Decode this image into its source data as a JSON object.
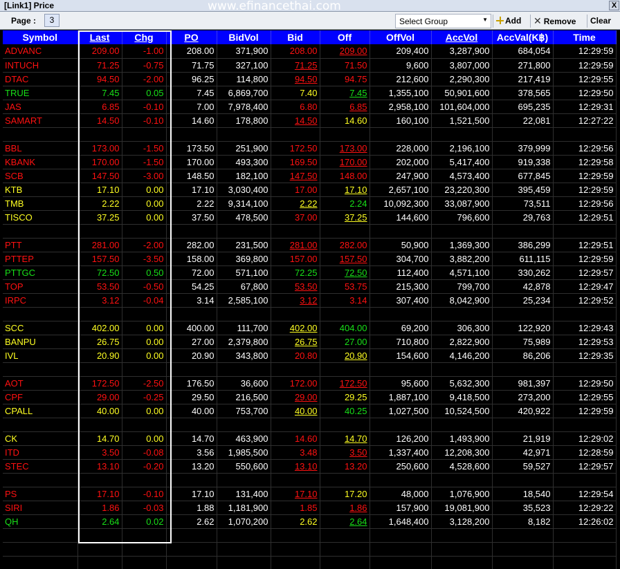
{
  "window": {
    "title": "[Link1] Price",
    "watermark": "www.efinancethai.com",
    "close": "X"
  },
  "toolbar": {
    "page_label": "Page :",
    "page_value": "3",
    "group_placeholder": "Select Group",
    "add": "Add",
    "remove": "Remove",
    "clear": "Clear"
  },
  "columns": [
    "Symbol",
    "Last",
    "Chg",
    "PO",
    "BidVol",
    "Bid",
    "Off",
    "OffVol",
    "AccVol",
    "AccVal(K฿)",
    "Time"
  ],
  "colors": {
    "up": "#18e018",
    "down": "#ff1111",
    "unchanged": "#ffff22",
    "header": "#0000ff"
  },
  "groups": [
    [
      [
        "ADVANC",
        "209.00",
        "-1.00",
        "208.00",
        "371,900",
        "208.00",
        "209.00",
        "209,400",
        "3,287,900",
        "684,054",
        "12:29:59",
        "r",
        "r",
        "r",
        "wh",
        "r",
        "ru",
        "wh"
      ],
      [
        "INTUCH",
        "71.25",
        "-0.75",
        "71.75",
        "327,100",
        "71.25",
        "71.50",
        "9,600",
        "3,807,000",
        "271,800",
        "12:29:59",
        "r",
        "r",
        "r",
        "wh",
        "ru",
        "r",
        "wh"
      ],
      [
        "DTAC",
        "94.50",
        "-2.00",
        "96.25",
        "114,800",
        "94.50",
        "94.75",
        "212,600",
        "2,290,300",
        "217,419",
        "12:29:55",
        "r",
        "r",
        "r",
        "wh",
        "ru",
        "r",
        "wh"
      ],
      [
        "TRUE",
        "7.45",
        "0.05",
        "7.45",
        "6,869,700",
        "7.40",
        "7.45",
        "1,355,100",
        "50,901,600",
        "378,565",
        "12:29:50",
        "g",
        "g",
        "g",
        "wh",
        "y",
        "gu",
        "wh"
      ],
      [
        "JAS",
        "6.85",
        "-0.10",
        "7.00",
        "7,978,400",
        "6.80",
        "6.85",
        "2,958,100",
        "101,604,000",
        "695,235",
        "12:29:31",
        "r",
        "r",
        "r",
        "wh",
        "r",
        "ru",
        "wh"
      ],
      [
        "SAMART",
        "14.50",
        "-0.10",
        "14.60",
        "178,800",
        "14.50",
        "14.60",
        "160,100",
        "1,521,500",
        "22,081",
        "12:27:22",
        "r",
        "r",
        "r",
        "wh",
        "ru",
        "y",
        "wh"
      ]
    ],
    [
      [
        "BBL",
        "173.00",
        "-1.50",
        "173.50",
        "251,900",
        "172.50",
        "173.00",
        "228,000",
        "2,196,100",
        "379,999",
        "12:29:56",
        "r",
        "r",
        "r",
        "wh",
        "r",
        "ru",
        "wh"
      ],
      [
        "KBANK",
        "170.00",
        "-1.50",
        "170.00",
        "493,300",
        "169.50",
        "170.00",
        "202,000",
        "5,417,400",
        "919,338",
        "12:29:58",
        "r",
        "r",
        "r",
        "wh",
        "r",
        "ru",
        "wh"
      ],
      [
        "SCB",
        "147.50",
        "-3.00",
        "148.50",
        "182,100",
        "147.50",
        "148.00",
        "247,900",
        "4,573,400",
        "677,845",
        "12:29:59",
        "r",
        "r",
        "r",
        "wh",
        "ru",
        "r",
        "wh"
      ],
      [
        "KTB",
        "17.10",
        "0.00",
        "17.10",
        "3,030,400",
        "17.00",
        "17.10",
        "2,657,100",
        "23,220,300",
        "395,459",
        "12:29:59",
        "y",
        "y",
        "y",
        "wh",
        "r",
        "yu",
        "wh"
      ],
      [
        "TMB",
        "2.22",
        "0.00",
        "2.22",
        "9,314,100",
        "2.22",
        "2.24",
        "10,092,300",
        "33,087,900",
        "73,511",
        "12:29:56",
        "y",
        "y",
        "y",
        "wh",
        "yu",
        "g",
        "wh"
      ],
      [
        "TISCO",
        "37.25",
        "0.00",
        "37.50",
        "478,500",
        "37.00",
        "37.25",
        "144,600",
        "796,600",
        "29,763",
        "12:29:51",
        "y",
        "y",
        "y",
        "wh",
        "r",
        "yu",
        "wh"
      ]
    ],
    [
      [
        "PTT",
        "281.00",
        "-2.00",
        "282.00",
        "231,500",
        "281.00",
        "282.00",
        "50,900",
        "1,369,300",
        "386,299",
        "12:29:51",
        "r",
        "r",
        "r",
        "wh",
        "ru",
        "r",
        "wh"
      ],
      [
        "PTTEP",
        "157.50",
        "-3.50",
        "158.00",
        "369,800",
        "157.00",
        "157.50",
        "304,700",
        "3,882,200",
        "611,115",
        "12:29:59",
        "r",
        "r",
        "r",
        "wh",
        "r",
        "ru",
        "wh"
      ],
      [
        "PTTGC",
        "72.50",
        "0.50",
        "72.00",
        "571,100",
        "72.25",
        "72.50",
        "112,400",
        "4,571,100",
        "330,262",
        "12:29:57",
        "g",
        "g",
        "g",
        "wh",
        "g",
        "gu",
        "wh"
      ],
      [
        "TOP",
        "53.50",
        "-0.50",
        "54.25",
        "67,800",
        "53.50",
        "53.75",
        "215,300",
        "799,700",
        "42,878",
        "12:29:47",
        "r",
        "r",
        "r",
        "wh",
        "ru",
        "r",
        "wh"
      ],
      [
        "IRPC",
        "3.12",
        "-0.04",
        "3.14",
        "2,585,100",
        "3.12",
        "3.14",
        "307,400",
        "8,042,900",
        "25,234",
        "12:29:52",
        "r",
        "r",
        "r",
        "wh",
        "ru",
        "r",
        "wh"
      ]
    ],
    [
      [
        "SCC",
        "402.00",
        "0.00",
        "400.00",
        "111,700",
        "402.00",
        "404.00",
        "69,200",
        "306,300",
        "122,920",
        "12:29:43",
        "y",
        "y",
        "y",
        "wh",
        "yu",
        "g",
        "wh"
      ],
      [
        "BANPU",
        "26.75",
        "0.00",
        "27.00",
        "2,379,800",
        "26.75",
        "27.00",
        "710,800",
        "2,822,900",
        "75,989",
        "12:29:53",
        "y",
        "y",
        "y",
        "wh",
        "yu",
        "g",
        "wh"
      ],
      [
        "IVL",
        "20.90",
        "0.00",
        "20.90",
        "343,800",
        "20.80",
        "20.90",
        "154,600",
        "4,146,200",
        "86,206",
        "12:29:35",
        "y",
        "y",
        "y",
        "wh",
        "r",
        "yu",
        "wh"
      ]
    ],
    [
      [
        "AOT",
        "172.50",
        "-2.50",
        "176.50",
        "36,600",
        "172.00",
        "172.50",
        "95,600",
        "5,632,300",
        "981,397",
        "12:29:50",
        "r",
        "r",
        "r",
        "wh",
        "r",
        "ru",
        "wh"
      ],
      [
        "CPF",
        "29.00",
        "-0.25",
        "29.50",
        "216,500",
        "29.00",
        "29.25",
        "1,887,100",
        "9,418,500",
        "273,200",
        "12:29:55",
        "r",
        "r",
        "r",
        "wh",
        "ru",
        "y",
        "wh"
      ],
      [
        "CPALL",
        "40.00",
        "0.00",
        "40.00",
        "753,700",
        "40.00",
        "40.25",
        "1,027,500",
        "10,524,500",
        "420,922",
        "12:29:59",
        "y",
        "y",
        "y",
        "wh",
        "yu",
        "g",
        "wh"
      ]
    ],
    [
      [
        "CK",
        "14.70",
        "0.00",
        "14.70",
        "463,900",
        "14.60",
        "14.70",
        "126,200",
        "1,493,900",
        "21,919",
        "12:29:02",
        "y",
        "y",
        "y",
        "wh",
        "r",
        "yu",
        "wh"
      ],
      [
        "ITD",
        "3.50",
        "-0.08",
        "3.56",
        "1,985,500",
        "3.48",
        "3.50",
        "1,337,400",
        "12,208,300",
        "42,971",
        "12:28:59",
        "r",
        "r",
        "r",
        "wh",
        "r",
        "ru",
        "wh"
      ],
      [
        "STEC",
        "13.10",
        "-0.20",
        "13.20",
        "550,600",
        "13.10",
        "13.20",
        "250,600",
        "4,528,600",
        "59,527",
        "12:29:57",
        "r",
        "r",
        "r",
        "wh",
        "ru",
        "r",
        "wh"
      ]
    ],
    [
      [
        "PS",
        "17.10",
        "-0.10",
        "17.10",
        "131,400",
        "17.10",
        "17.20",
        "48,000",
        "1,076,900",
        "18,540",
        "12:29:54",
        "r",
        "r",
        "r",
        "wh",
        "ru",
        "y",
        "wh"
      ],
      [
        "SIRI",
        "1.86",
        "-0.03",
        "1.88",
        "1,181,900",
        "1.85",
        "1.86",
        "157,900",
        "19,081,900",
        "35,523",
        "12:29:22",
        "r",
        "r",
        "r",
        "wh",
        "r",
        "ru",
        "wh"
      ],
      [
        "QH",
        "2.64",
        "0.02",
        "2.62",
        "1,070,200",
        "2.62",
        "2.64",
        "1,648,400",
        "3,128,200",
        "8,182",
        "12:26:02",
        "g",
        "g",
        "g",
        "wh",
        "y",
        "gu",
        "wh"
      ]
    ]
  ]
}
